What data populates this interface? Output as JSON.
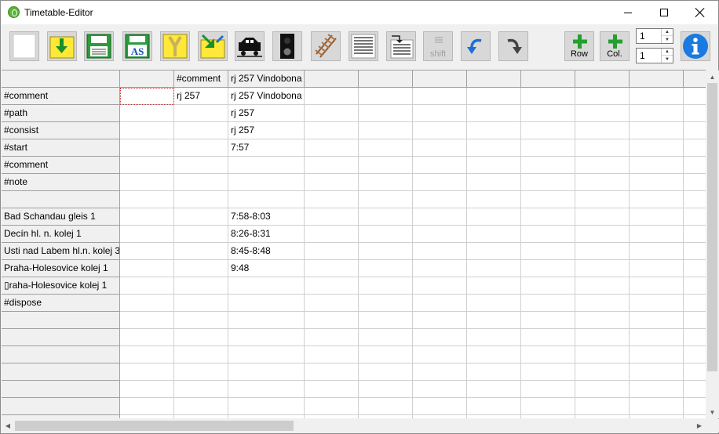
{
  "window": {
    "title": "Timetable-Editor"
  },
  "toolbar": {
    "buttons": [
      {
        "name": "new-file-button",
        "icon": "blank-page-icon"
      },
      {
        "name": "open-file-button",
        "icon": "folder-download-icon"
      },
      {
        "name": "save-button",
        "icon": "floppy-disk-icon"
      },
      {
        "name": "save-as-button",
        "icon": "floppy-disk-as-icon",
        "text": "AS"
      },
      {
        "name": "merge-button",
        "icon": "merge-y-icon"
      },
      {
        "name": "import-button",
        "icon": "folder-import-icon"
      },
      {
        "name": "train-button",
        "icon": "train-icon"
      },
      {
        "name": "signal-button",
        "icon": "signal-icon"
      },
      {
        "name": "track-button",
        "icon": "track-icon"
      },
      {
        "name": "list-button",
        "icon": "lines-list-icon"
      },
      {
        "name": "insert-list-button",
        "icon": "insert-lines-icon"
      },
      {
        "name": "shift-button",
        "icon": "shift-icon"
      },
      {
        "name": "undo-button",
        "icon": "undo-arrow-icon"
      },
      {
        "name": "redo-button",
        "icon": "redo-arrow-icon"
      }
    ],
    "shift_label": "shift",
    "add_row_label": "Row",
    "add_col_label": "Col.",
    "spin_row_value": "1",
    "spin_col_value": "1",
    "colors": {
      "folder_yellow": "#ffe838",
      "floppy_green": "#2a9d3a",
      "arrow_blue": "#1a6fd8",
      "plus_green": "#23a02d",
      "info_blue": "#1a7ae0"
    }
  },
  "grid": {
    "column_headers": [
      "",
      "",
      "#comment",
      "rj 257 Vindobona",
      "",
      "",
      "",
      "",
      "",
      "",
      "",
      ""
    ],
    "rows": [
      [
        "#comment",
        "",
        "rj 257",
        " rj 257 Vindobona"
      ],
      [
        "#path",
        "",
        "",
        "rj 257"
      ],
      [
        "#consist",
        "",
        "",
        "rj 257"
      ],
      [
        "#start",
        "",
        "",
        "7:57"
      ],
      [
        "#comment",
        "",
        "",
        ""
      ],
      [
        "#note",
        "",
        "",
        ""
      ],
      [
        "",
        "",
        "",
        ""
      ],
      [
        "Bad Schandau gleis 1",
        "",
        "",
        "7:58-8:03"
      ],
      [
        "Decín hl. n. kolej 1",
        "",
        "",
        "8:26-8:31"
      ],
      [
        "Usti nad Labem hl.n. kolej 3",
        "",
        "",
        "8:45-8:48"
      ],
      [
        "Praha-Holesovice kolej 1",
        "",
        "",
        "9:48"
      ],
      [
        "▯raha-Holesovice kolej 1",
        "",
        "",
        ""
      ],
      [
        "#dispose",
        "",
        "",
        ""
      ],
      [
        "",
        "",
        "",
        ""
      ],
      [
        "",
        "",
        "",
        ""
      ],
      [
        "",
        "",
        "",
        ""
      ],
      [
        "",
        "",
        "",
        ""
      ],
      [
        "",
        "",
        "",
        ""
      ],
      [
        "",
        "",
        "",
        ""
      ],
      [
        "",
        "",
        "",
        ""
      ]
    ]
  }
}
